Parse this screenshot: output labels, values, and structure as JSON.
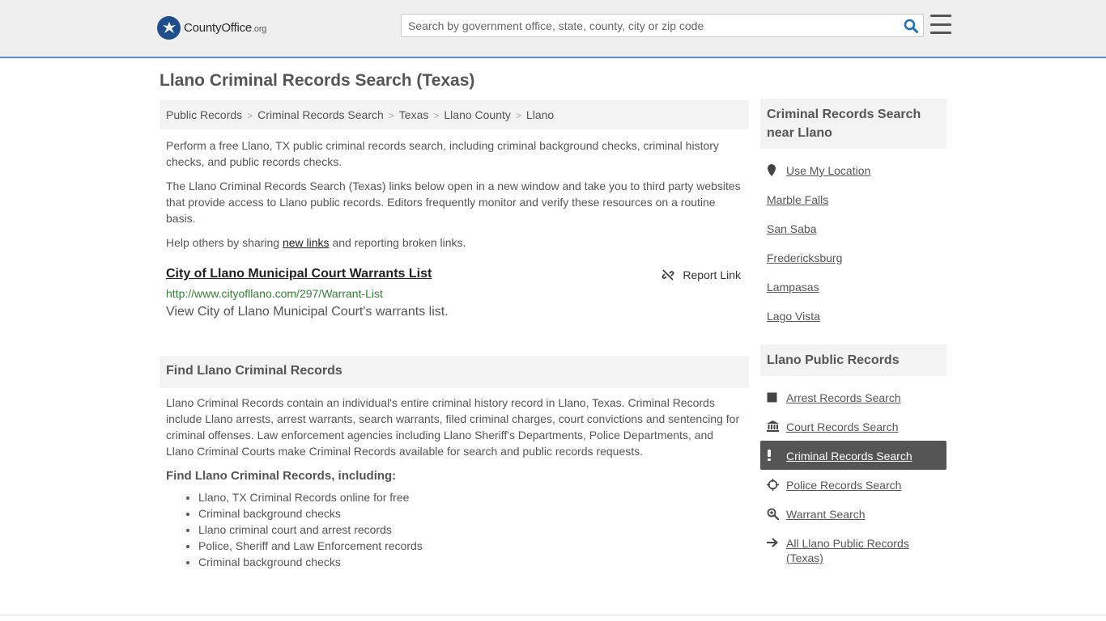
{
  "header": {
    "logo_text": "CountyOffice",
    "logo_suffix": ".org",
    "search_placeholder": "Search by government office, state, county, city or zip code"
  },
  "page_title": "Llano Criminal Records Search (Texas)",
  "breadcrumb": [
    "Public Records",
    "Criminal Records Search",
    "Texas",
    "Llano County",
    "Llano"
  ],
  "intro": {
    "p1": "Perform a free Llano, TX public criminal records search, including criminal background checks, criminal history checks, and public records checks.",
    "p2": "The Llano Criminal Records Search (Texas) links below open in a new window and take you to third party websites that provide access to Llano public records. Editors frequently monitor and verify these resources on a routine basis.",
    "p3_before": "Help others by sharing ",
    "p3_link": "new links",
    "p3_after": " and reporting broken links."
  },
  "link_card": {
    "title": "City of Llano Municipal Court Warrants List",
    "report_label": "Report Link",
    "url": "http://www.cityofllano.com/297/Warrant-List",
    "description": "View City of Llano Municipal Court's warrants list."
  },
  "find_section": {
    "heading": "Find Llano Criminal Records",
    "body": "Llano Criminal Records contain an individual's entire criminal history record in Llano, Texas. Criminal Records include Llano arrests, arrest warrants, search warrants, filed criminal charges, court convictions and sentencing for criminal offenses. Law enforcement agencies including Llano Sheriff's Departments, Police Departments, and Llano Criminal Courts make Criminal Records available for search and public records requests.",
    "subheading": "Find Llano Criminal Records, including:",
    "items": [
      "Llano, TX Criminal Records online for free",
      "Criminal background checks",
      "Llano criminal court and arrest records",
      "Police, Sheriff and Law Enforcement records",
      "Criminal background checks"
    ]
  },
  "sidebar": {
    "nearby_heading": "Criminal Records Search near Llano",
    "nearby": [
      "Use My Location",
      "Marble Falls",
      "San Saba",
      "Fredericksburg",
      "Lampasas",
      "Lago Vista"
    ],
    "public_heading": "Llano Public Records",
    "public": [
      {
        "label": "Arrest Records Search",
        "icon": "square-icon"
      },
      {
        "label": "Court Records Search",
        "icon": "courthouse-icon"
      },
      {
        "label": "Criminal Records Search",
        "icon": "exclamation-icon",
        "active": true
      },
      {
        "label": "Police Records Search",
        "icon": "crosshair-icon"
      },
      {
        "label": "Warrant Search",
        "icon": "magnify-plus-icon"
      },
      {
        "label": "All Llano Public Records (Texas)",
        "icon": "arrow-right-icon"
      }
    ]
  },
  "colors": {
    "header_bg": "#efefef",
    "header_border": "#5d8ec1",
    "active_item_bg": "#555555",
    "url_green": "#3a7a3a",
    "logo_blue": "#1f4e8c",
    "search_icon_blue": "#1f6fb5"
  }
}
